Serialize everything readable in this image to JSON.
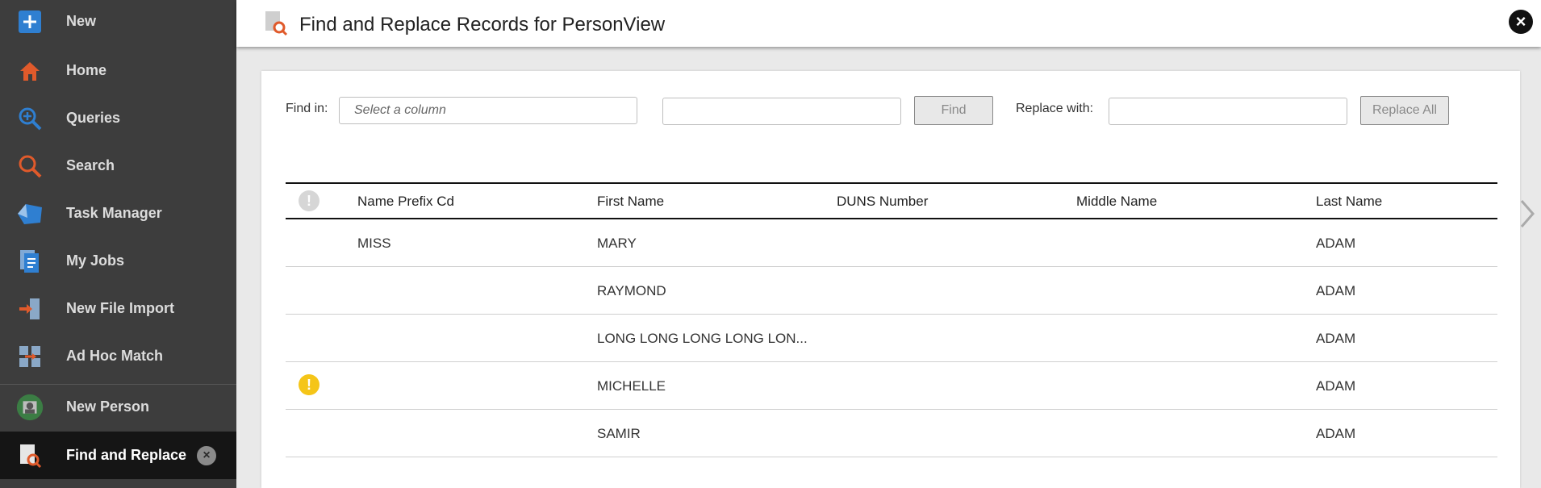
{
  "sidebar": {
    "items": [
      {
        "label": "New",
        "icon": "plus-icon"
      },
      {
        "label": "Home",
        "icon": "home-icon"
      },
      {
        "label": "Queries",
        "icon": "zoom-in-icon"
      },
      {
        "label": "Search",
        "icon": "search-icon"
      },
      {
        "label": "Task Manager",
        "icon": "task-manager-icon"
      },
      {
        "label": "My Jobs",
        "icon": "jobs-icon"
      },
      {
        "label": "New File Import",
        "icon": "file-import-icon"
      },
      {
        "label": "Ad Hoc Match",
        "icon": "ad-hoc-match-icon"
      },
      {
        "label": "New Person",
        "icon": "person-avatar-icon"
      },
      {
        "label": "Find and Replace",
        "icon": "find-replace-icon",
        "active": true
      }
    ]
  },
  "header": {
    "title": "Find and Replace Records for PersonView"
  },
  "toolbar": {
    "find_in_label": "Find in:",
    "column_placeholder": "Select a column",
    "find_value": "",
    "find_button": "Find",
    "replace_with_label": "Replace with:",
    "replace_value": "",
    "replace_all_button": "Replace All"
  },
  "table": {
    "columns": [
      "Name Prefix Cd",
      "First Name",
      "DUNS Number",
      "Middle Name",
      "Last Name"
    ],
    "rows": [
      {
        "warning": false,
        "name_prefix_cd": "MISS",
        "first_name": "MARY",
        "duns_number": "",
        "middle_name": "",
        "last_name": "ADAM"
      },
      {
        "warning": false,
        "name_prefix_cd": "",
        "first_name": "RAYMOND",
        "duns_number": "",
        "middle_name": "",
        "last_name": "ADAM"
      },
      {
        "warning": false,
        "name_prefix_cd": "",
        "first_name": "LONG LONG LONG LONG LON...",
        "duns_number": "",
        "middle_name": "",
        "last_name": "ADAM"
      },
      {
        "warning": true,
        "name_prefix_cd": "",
        "first_name": "MICHELLE",
        "duns_number": "",
        "middle_name": "",
        "last_name": "ADAM"
      },
      {
        "warning": false,
        "name_prefix_cd": "",
        "first_name": "SAMIR",
        "duns_number": "",
        "middle_name": "",
        "last_name": "ADAM"
      }
    ]
  },
  "colors": {
    "sidebar_bg": "#3d3d3d",
    "active_bg": "#151515",
    "warning": "#f5c518",
    "accent_orange": "#e05a2b",
    "accent_blue": "#2f7fd1"
  }
}
